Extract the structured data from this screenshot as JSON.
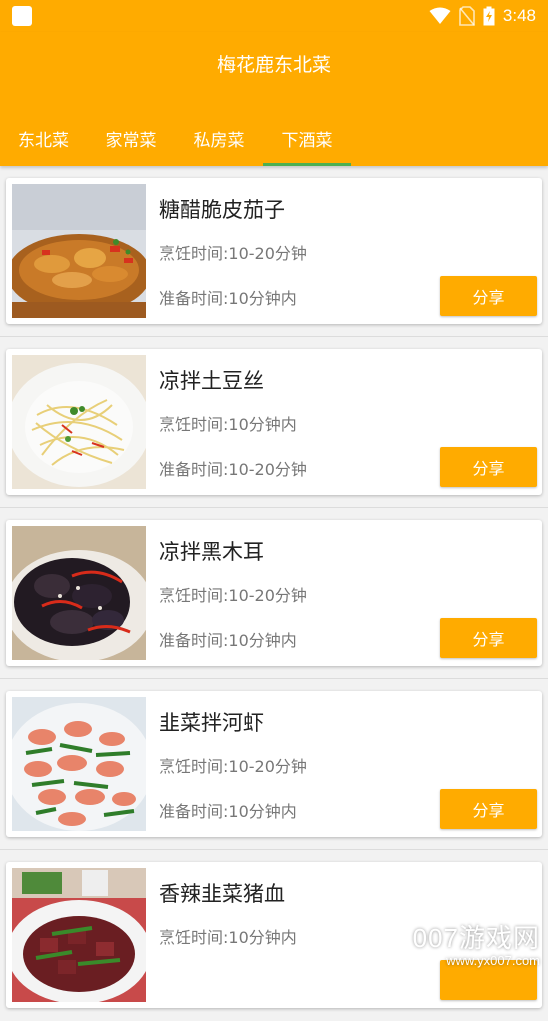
{
  "status_bar": {
    "time": "3:48"
  },
  "app": {
    "title": "梅花鹿东北菜"
  },
  "tabs": [
    {
      "label": "东北菜",
      "active": false
    },
    {
      "label": "家常菜",
      "active": false
    },
    {
      "label": "私房菜",
      "active": false
    },
    {
      "label": "下酒菜",
      "active": true
    }
  ],
  "recipes": [
    {
      "name": "糖醋脆皮茄子",
      "cook_time": "烹饪时间:10-20分钟",
      "prep_time": "准备时间:10分钟内",
      "share_label": "分享"
    },
    {
      "name": "凉拌土豆丝",
      "cook_time": "烹饪时间:10分钟内",
      "prep_time": "准备时间:10-20分钟",
      "share_label": "分享"
    },
    {
      "name": "凉拌黑木耳",
      "cook_time": "烹饪时间:10-20分钟",
      "prep_time": "准备时间:10分钟内",
      "share_label": "分享"
    },
    {
      "name": "韭菜拌河虾",
      "cook_time": "烹饪时间:10-20分钟",
      "prep_time": "准备时间:10分钟内",
      "share_label": "分享"
    },
    {
      "name": "香辣韭菜猪血",
      "cook_time": "烹饪时间:10分钟内",
      "prep_time": "",
      "share_label": ""
    }
  ],
  "watermark": {
    "main": "007游戏网",
    "url": "www.yx007.com"
  },
  "colors": {
    "primary": "#ffab00",
    "tab_indicator": "#4caf50"
  }
}
